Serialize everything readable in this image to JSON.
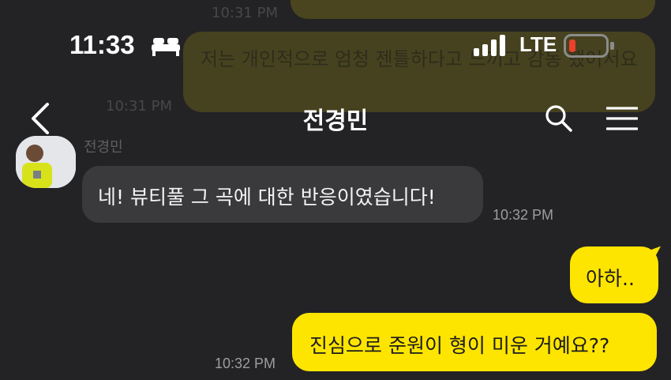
{
  "status_bar": {
    "time": "11:33",
    "network": "LTE",
    "battery_color": "#e8412c"
  },
  "background_ghost": {
    "text": "저는 개인적으로 엄청 젠틀하다고 느끼고 감동 했어서요"
  },
  "header": {
    "title": "전경민",
    "icons": [
      "back-icon",
      "search-icon",
      "menu-icon"
    ]
  },
  "messages": [
    {
      "direction": "incoming",
      "sender": "전경민",
      "text": "네! 뷰티풀 그 곡에 대한 반응이였습니다!",
      "time": "10:32 PM"
    },
    {
      "direction": "outgoing",
      "text": "아하..",
      "time": ""
    },
    {
      "direction": "outgoing",
      "text": "진심으로 준원이 형이 미운 거예요??",
      "time": "10:32 PM"
    }
  ],
  "colors": {
    "background": "#232326",
    "incoming_bubble": "#3a3a3d",
    "outgoing_bubble": "#fee500"
  }
}
